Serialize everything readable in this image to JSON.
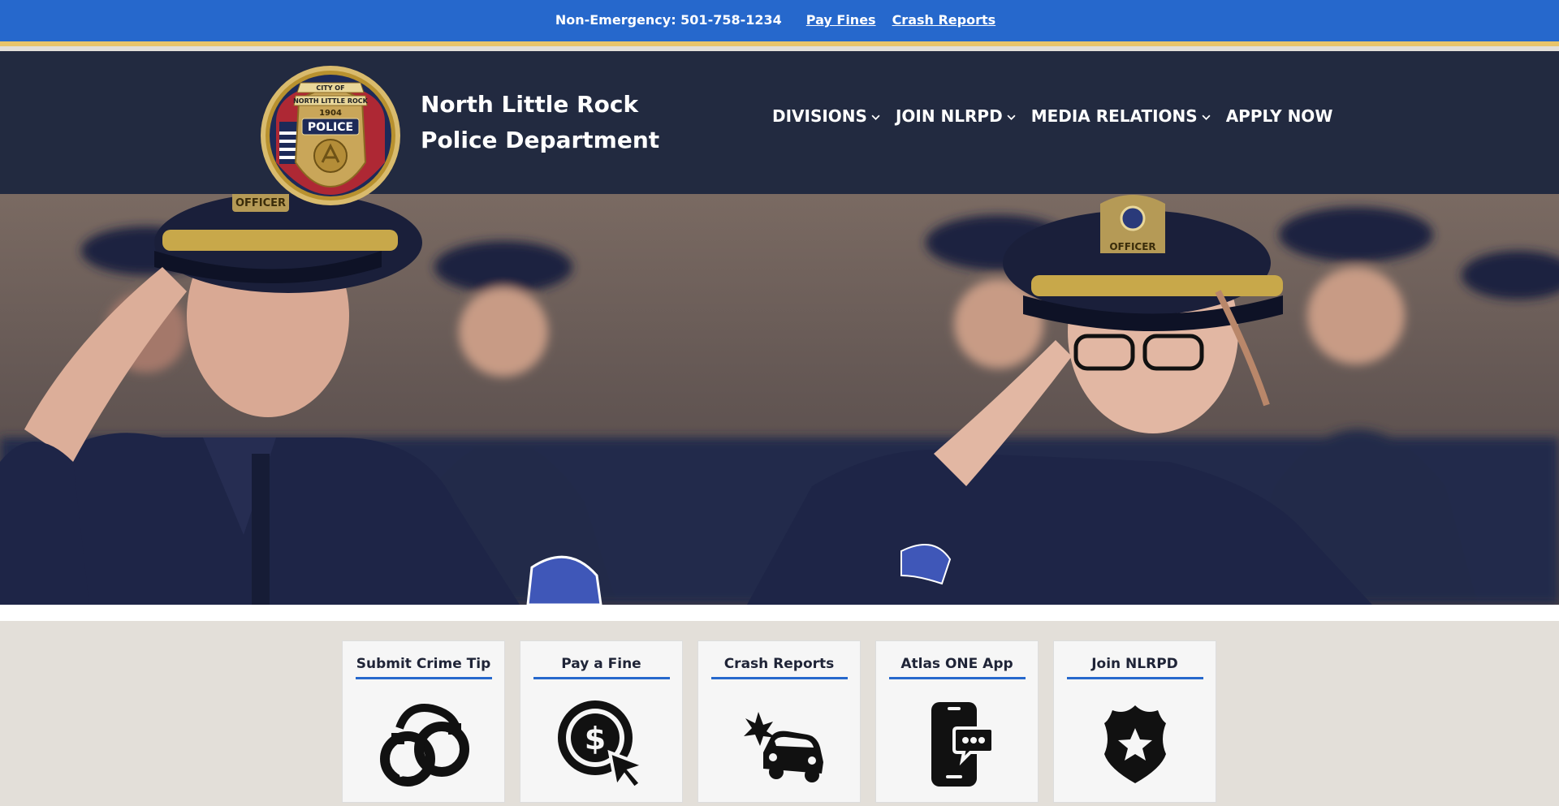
{
  "utility": {
    "phone": "Non-Emergency: 501-758-1234",
    "links": [
      "Pay Fines",
      "Crash Reports"
    ]
  },
  "header": {
    "dept_line1": "North Little Rock",
    "dept_line2": "Police Department",
    "seal": {
      "top_text": "CITY OF",
      "city_text": "NORTH LITTLE ROCK",
      "year": "1904",
      "badge_text": "POLICE"
    }
  },
  "nav": {
    "items": [
      {
        "label": "DIVISIONS",
        "dropdown": true
      },
      {
        "label": "JOIN NLRPD",
        "dropdown": true
      },
      {
        "label": "MEDIA RELATIONS",
        "dropdown": true
      },
      {
        "label": "APPLY NOW",
        "dropdown": false
      }
    ]
  },
  "hero": {
    "cap_badge_text": "OFFICER"
  },
  "quick_links": [
    {
      "title": "Submit Crime Tip",
      "icon": "handcuffs-icon"
    },
    {
      "title": "Pay a Fine",
      "icon": "dollar-cursor-icon"
    },
    {
      "title": "Crash Reports",
      "icon": "car-crash-icon"
    },
    {
      "title": "Atlas ONE App",
      "icon": "phone-chat-icon"
    },
    {
      "title": "Join NLRPD",
      "icon": "police-badge-icon"
    }
  ],
  "colors": {
    "utility_bar": "#2668cc",
    "accent_gold": "#e9c46a",
    "header_navy": "#222a40",
    "page_bg": "#e3dfd9"
  }
}
